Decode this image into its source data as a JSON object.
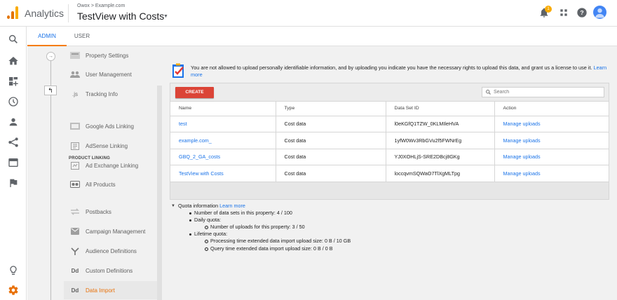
{
  "header": {
    "app_title": "Analytics",
    "breadcrumb": "Owox > Example.com",
    "view_title": "TestView with Costs",
    "notification_count": "1",
    "icons": [
      "analytics-logo-icon",
      "bell-icon",
      "apps-grid-icon",
      "help-icon",
      "avatar-icon"
    ]
  },
  "rail": {
    "icons": [
      "search-icon",
      "home-icon",
      "customization-icon",
      "realtime-clock-icon",
      "audience-person-icon",
      "acquisition-icon",
      "behavior-icon",
      "conversions-flag-icon",
      "discover-bulb-icon",
      "admin-gear-icon"
    ]
  },
  "tabs": [
    {
      "label": "ADMIN",
      "active": true
    },
    {
      "label": "USER",
      "active": false
    }
  ],
  "menu": {
    "section_label": "PRODUCT LINKING",
    "items": [
      {
        "label": "Property Settings",
        "icon": "property-settings-icon"
      },
      {
        "label": "User Management",
        "icon": "users-icon"
      },
      {
        "label": "Tracking Info",
        "icon": "js-icon"
      },
      {
        "label": "Google Ads Linking",
        "icon": "google-ads-icon"
      },
      {
        "label": "AdSense Linking",
        "icon": "adsense-icon"
      },
      {
        "label": "Ad Exchange Linking",
        "icon": "ad-exchange-icon"
      },
      {
        "label": "All Products",
        "icon": "all-products-icon"
      },
      {
        "label": "Postbacks",
        "icon": "postbacks-icon"
      },
      {
        "label": "Campaign Management",
        "icon": "campaign-icon"
      },
      {
        "label": "Audience Definitions",
        "icon": "audience-definitions-icon"
      },
      {
        "label": "Custom Definitions",
        "icon": "custom-definitions-icon"
      },
      {
        "label": "Data Import",
        "icon": "data-import-icon",
        "active": true
      }
    ],
    "js_glyph": ".js",
    "dd_glyph": "Dd"
  },
  "notice": {
    "text": "You are not allowed to upload personally identifiable information, and by uploading you indicate you have the necessary rights to upload this data, and grant us a license to use it.",
    "link": "Learn more"
  },
  "toolbar": {
    "create_label": "CREATE",
    "search_placeholder": "Search"
  },
  "table": {
    "columns": [
      "Name",
      "Type",
      "Data Set ID",
      "Action"
    ],
    "rows": [
      {
        "name": "test",
        "type": "Cost data",
        "id": "l0eKGfQ1TZW_0KLMIleHVA",
        "action": "Manage uploads"
      },
      {
        "name": "example.com_",
        "type": "Cost data",
        "id": "1yfW0Wv3RbGVu2f5FWNrEg",
        "action": "Manage uploads"
      },
      {
        "name": "GBQ_2_GA_costs",
        "type": "Cost data",
        "id": "YJ0XOHLjS-SRE2DBcj8GKg",
        "action": "Manage uploads"
      },
      {
        "name": "TestView with Costs",
        "type": "Cost data",
        "id": "loccqvmSQWaO7TlXgMLTpg",
        "action": "Manage uploads"
      }
    ]
  },
  "quota": {
    "title": "Quota information",
    "link": "Learn more",
    "data_sets": "Number of data sets in this property: 4 / 100",
    "daily_label": "Daily quota:",
    "daily_uploads": "Number of uploads for this property: 3 / 50",
    "lifetime_label": "Lifetime quota:",
    "processing": "Processing time extended data import upload size: 0 B / 10 GB",
    "query": "Query time extended data import upload size: 0 B / 0 B"
  },
  "colors": {
    "accent_blue": "#1a73e8",
    "create_red": "#db4437",
    "active_orange": "#e8710a",
    "logo_orange": "#f9ab00"
  }
}
